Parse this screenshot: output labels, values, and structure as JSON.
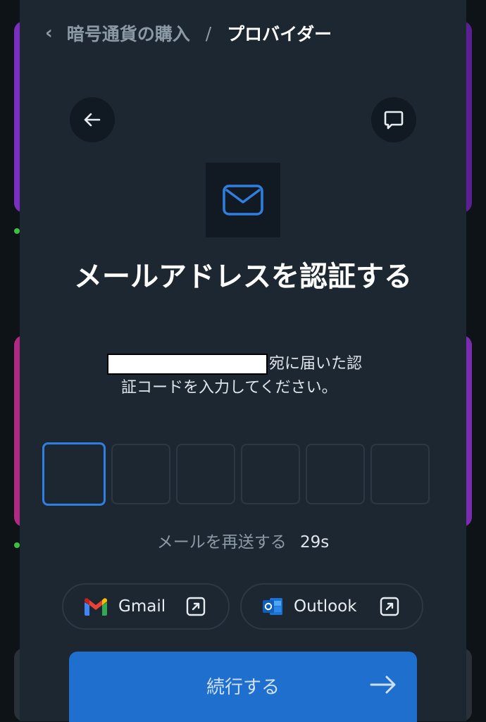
{
  "breadcrumb": {
    "parent": "暗号通貨の購入",
    "separator": "/",
    "current": "プロバイダー"
  },
  "heading": {
    "title": "メールアドレスを認証する",
    "description_line1": "宛に届いた認",
    "description_line2": "証コードを入力してください。"
  },
  "otp": {
    "length": 6,
    "active_index": 0
  },
  "resend": {
    "label": "メールを再送する",
    "timer": "29s"
  },
  "mail_apps": [
    {
      "name": "Gmail"
    },
    {
      "name": "Outlook"
    }
  ],
  "continue_button": {
    "label": "続行する"
  },
  "colors": {
    "accent": "#2f7fe0",
    "button": "#1f6fcf",
    "sheet": "#1c2731"
  }
}
